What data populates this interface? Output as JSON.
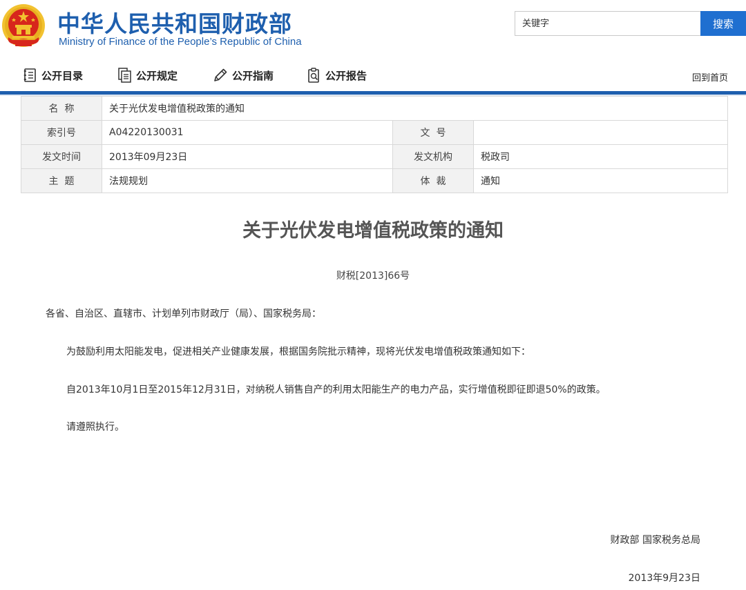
{
  "header": {
    "title_cn": "中华人民共和国财政部",
    "title_en": "Ministry of Finance of the People’s Republic of China"
  },
  "search": {
    "placeholder": "关键字",
    "button_label": "搜索"
  },
  "nav": {
    "items": [
      {
        "label": "公开目录",
        "icon": "catalog-icon"
      },
      {
        "label": "公开规定",
        "icon": "documents-icon"
      },
      {
        "label": "公开指南",
        "icon": "pencil-icon"
      },
      {
        "label": "公开报告",
        "icon": "report-icon"
      }
    ],
    "home_label": "回到首页"
  },
  "meta": {
    "name_label": "名  称",
    "name_value": "关于光伏发电增值税政策的通知",
    "index_label": "索引号",
    "index_value": "A04220130031",
    "docno_label": "文  号",
    "docno_value": "",
    "date_label": "发文时间",
    "date_value": "2013年09月23日",
    "org_label": "发文机构",
    "org_value": "税政司",
    "topic_label": "主  题",
    "topic_value": "法规规划",
    "genre_label": "体  裁",
    "genre_value": "通知"
  },
  "document": {
    "title": "关于光伏发电增值税政策的通知",
    "number": "财税[2013]66号",
    "addressee": "各省、自治区、直辖市、计划单列市财政厅（局）、国家税务局：",
    "paragraphs": [
      "为鼓励利用太阳能发电，促进相关产业健康发展，根据国务院批示精神，现将光伏发电增值税政策通知如下：",
      "自2013年10月1日至2015年12月31日，对纳税人销售自产的利用太阳能生产的电力产品，实行增值税即征即退50%的政策。",
      "请遵照执行。"
    ],
    "signature": "财政部 国家税务总局",
    "sign_date": "2013年9月23日"
  },
  "colors": {
    "brand_blue": "#1e5fae",
    "search_button": "#1f6fd0",
    "emblem_red": "#d7261c",
    "emblem_gold": "#f2c230"
  }
}
